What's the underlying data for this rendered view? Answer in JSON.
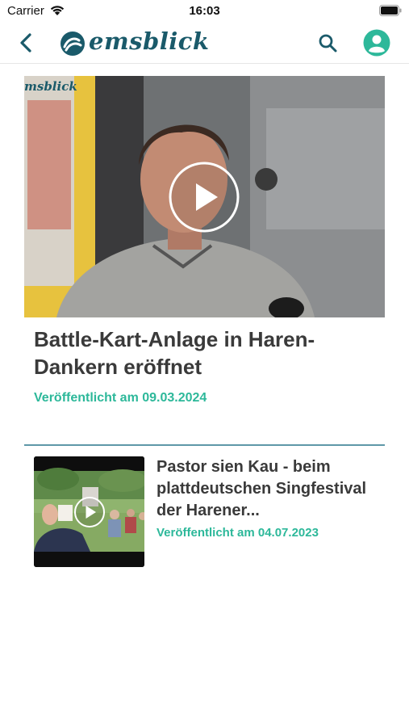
{
  "status_bar": {
    "carrier": "Carrier",
    "time": "16:03"
  },
  "nav": {
    "logo_text": "emsblick",
    "back_icon": "chevron-left-icon",
    "search_icon": "search-icon",
    "profile_icon": "user-circle-icon"
  },
  "featured": {
    "title": "Battle-Kart-Anlage in Haren-Dankern eröffnet",
    "date": "Veröffentlicht am 09.03.2024",
    "thumb_logo_text": "msblick"
  },
  "articles": [
    {
      "title": "Pastor sien Kau - beim plattdeutschen Singfestival der Harener...",
      "date": "Veröffentlicht am 04.07.2023"
    }
  ],
  "colors": {
    "brand": "#1a5a6a",
    "accent": "#2db89a",
    "divider": "#5f98a8"
  }
}
